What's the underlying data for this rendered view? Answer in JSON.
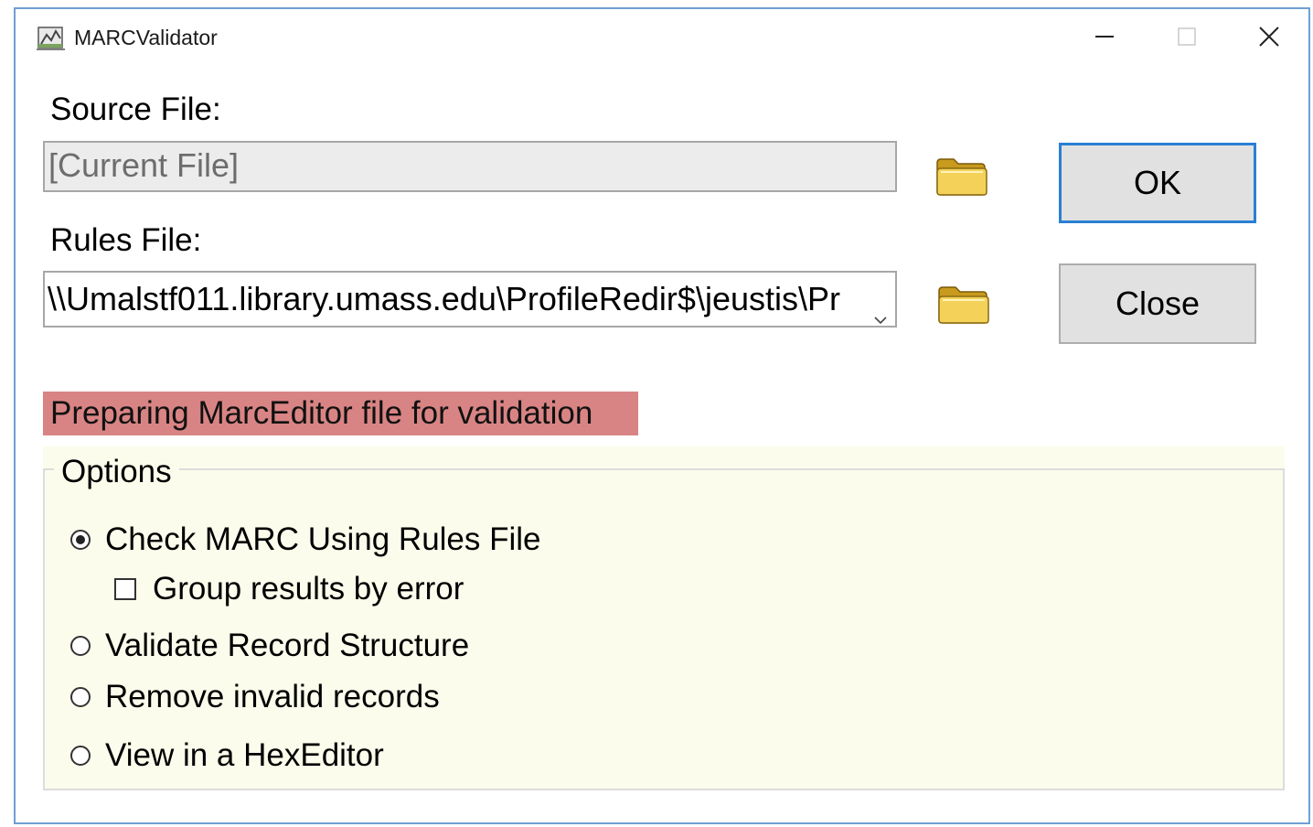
{
  "window": {
    "title": "MARCValidator",
    "icon": "marc-validator-app-icon"
  },
  "title_controls": {
    "minimize_icon": "minimize-icon",
    "maximize_icon": "maximize-icon",
    "close_icon": "close-icon"
  },
  "source": {
    "label": "Source File:",
    "value": "[Current File]",
    "browse_icon": "folder-icon"
  },
  "rules": {
    "label": "Rules File:",
    "value": "\\\\Umalstf011.library.umass.edu\\ProfileRedir$\\jeustis\\Pr",
    "browse_icon": "folder-icon",
    "dropdown_icon": "chevron-down-icon"
  },
  "buttons": {
    "ok": "OK",
    "close": "Close"
  },
  "status": {
    "text": "Preparing MarcEditor file for validation",
    "color": "#d98484"
  },
  "options": {
    "legend": "Options",
    "items": [
      {
        "label": "Check MARC Using Rules File",
        "type": "radio",
        "checked": true
      },
      {
        "label": "Group results by error",
        "type": "checkbox",
        "checked": false
      },
      {
        "label": "Validate Record Structure",
        "type": "radio",
        "checked": false
      },
      {
        "label": "Remove invalid records",
        "type": "radio",
        "checked": false
      },
      {
        "label": "View in a HexEditor",
        "type": "radio",
        "checked": false
      }
    ]
  },
  "colors": {
    "accent": "#2a7fd4",
    "window_border": "#6f9fd1",
    "options_background": "#fcfcec"
  }
}
